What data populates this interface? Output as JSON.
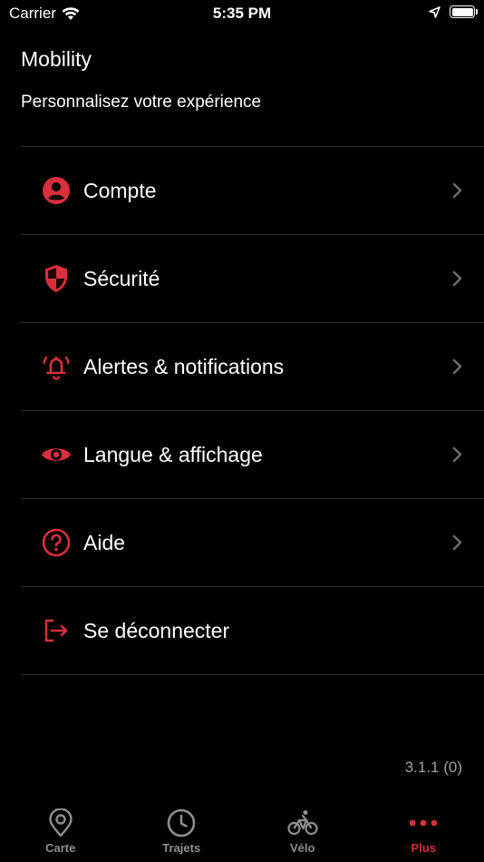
{
  "status_bar": {
    "carrier": "Carrier",
    "time": "5:35 PM"
  },
  "header": {
    "title": "Mobility",
    "subtitle": "Personnalisez votre expérience"
  },
  "menu": {
    "items": [
      {
        "label": "Compte",
        "icon": "user-circle-icon",
        "has_chevron": true
      },
      {
        "label": "Sécurité",
        "icon": "shield-icon",
        "has_chevron": true
      },
      {
        "label": "Alertes & notifications",
        "icon": "bell-ringing-icon",
        "has_chevron": true
      },
      {
        "label": "Langue & affichage",
        "icon": "eye-icon",
        "has_chevron": true
      },
      {
        "label": "Aide",
        "icon": "question-circle-icon",
        "has_chevron": true
      },
      {
        "label": "Se déconnecter",
        "icon": "logout-icon",
        "has_chevron": false
      }
    ]
  },
  "version": "3.1.1 (0)",
  "tab_bar": {
    "tabs": [
      {
        "label": "Carte",
        "icon": "map-pin-icon",
        "active": false
      },
      {
        "label": "Trajets",
        "icon": "clock-icon",
        "active": false
      },
      {
        "label": "Vélo",
        "icon": "bicycle-icon",
        "active": false
      },
      {
        "label": "Plus",
        "icon": "more-dots-icon",
        "active": true
      }
    ]
  },
  "colors": {
    "accent": "#d92f3d",
    "background": "#000000",
    "text": "#ffffff",
    "separator": "#2c2c2e",
    "inactive_tab": "#8e8e93",
    "chevron": "#6e6e73"
  }
}
